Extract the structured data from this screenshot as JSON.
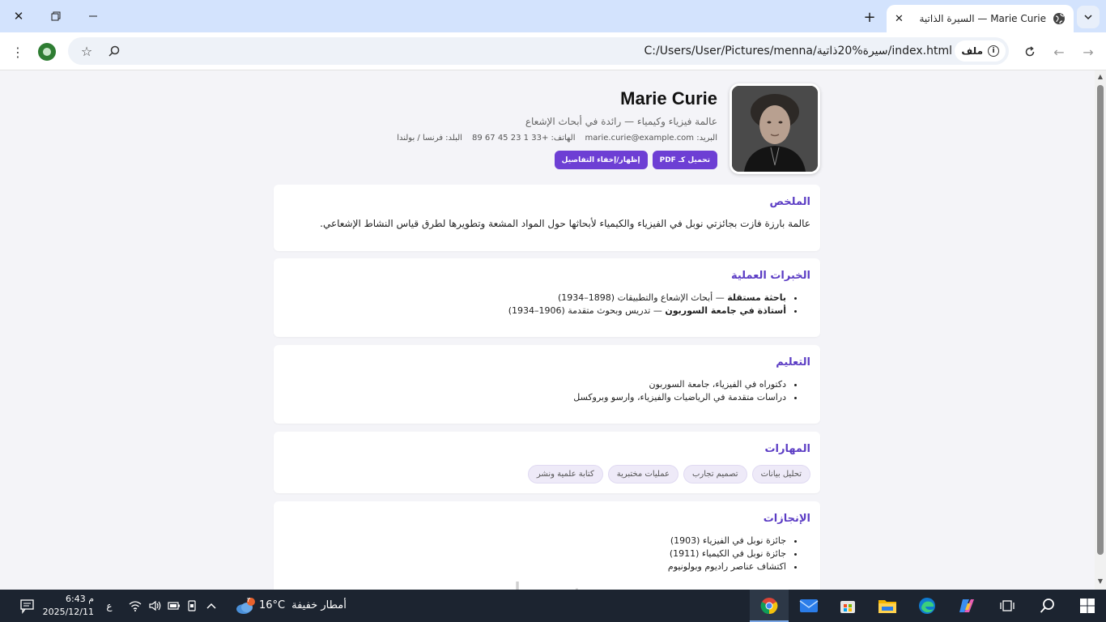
{
  "browser": {
    "tab_title": "السيرة الذاتية — Marie Curie",
    "url": "C:/Users/User/Pictures/menna/سيرة%20ذاتية/index.html",
    "site_chip": "ملف"
  },
  "resume": {
    "name": "Marie Curie",
    "title": "عالمة فيزياء وكيمياء — رائدة في أبحاث الإشعاع",
    "contact": {
      "email": "البريد: marie.curie@example.com",
      "phone": "الهاتف: +33 1 23 45 67 89",
      "country": "البلد: فرنسا / بولندا"
    },
    "buttons": {
      "pdf": "تحميل كـ PDF",
      "toggle": "إظهار/إخفاء التفاصيل"
    },
    "sections": {
      "summary": {
        "heading": "الملخص",
        "text": "عالمة بارزة فازت بجائزتي نوبل في الفيزياء والكيمياء لأبحاثها حول المواد المشعة وتطويرها لطرق قياس النشاط الإشعاعي."
      },
      "experience": {
        "heading": "الخبرات العملية",
        "items": [
          {
            "role": "باحثة مستقلة",
            "desc": " — أبحاث الإشعاع والتطبيقات (1898–1934)"
          },
          {
            "role": "أستاذة في جامعة السوربون",
            "desc": " — تدريس وبحوث متقدمة (1906–1934)"
          }
        ]
      },
      "education": {
        "heading": "التعليم",
        "items": [
          "دكتوراه في الفيزياء، جامعة السوربون",
          "دراسات متقدمة في الرياضيات والفيزياء، وارسو وبروكسل"
        ]
      },
      "skills": {
        "heading": "المهارات",
        "items": [
          "تحليل بيانات",
          "تصميم تجارب",
          "عمليات مختبرية",
          "كتابة علمية ونشر"
        ]
      },
      "achievements": {
        "heading": "الإنجازات",
        "items": [
          "جائزة نوبل في الفيزياء (1903)",
          "جائزة نوبل في الكيمياء (1911)",
          "اكتشاف عناصر راديوم وبولونيوم"
        ]
      }
    }
  },
  "watermark": "خمسات",
  "taskbar": {
    "time": "6:43 م",
    "date": "2025/12/11",
    "lang": "ع",
    "weather_temp": "16°C",
    "weather_desc": "أمطار خفيفة",
    "weather_badge": "٣"
  }
}
